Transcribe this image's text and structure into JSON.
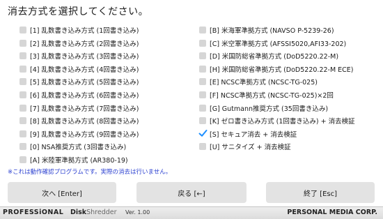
{
  "title": "消去方式を選択してください。",
  "options_left": [
    {
      "label": "[1] 乱数書き込み方式 (1回書き込み)",
      "checked": false
    },
    {
      "label": "[2] 乱数書き込み方式 (2回書き込み)",
      "checked": false
    },
    {
      "label": "[3] 乱数書き込み方式 (3回書き込み)",
      "checked": false
    },
    {
      "label": "[4] 乱数書き込み方式 (4回書き込み)",
      "checked": false
    },
    {
      "label": "[5] 乱数書き込み方式 (5回書き込み)",
      "checked": false
    },
    {
      "label": "[6] 乱数書き込み方式 (6回書き込み)",
      "checked": false
    },
    {
      "label": "[7] 乱数書き込み方式 (7回書き込み)",
      "checked": false
    },
    {
      "label": "[8] 乱数書き込み方式 (8回書き込み)",
      "checked": false
    },
    {
      "label": "[9] 乱数書き込み方式 (9回書き込み)",
      "checked": false
    },
    {
      "label": "[0] NSA推奨方式 (3回書き込み)",
      "checked": false
    },
    {
      "label": "[A] 米陸軍準拠方式 (AR380-19)",
      "checked": false
    }
  ],
  "options_right": [
    {
      "label": "[B] 米海軍準拠方式 (NAVSO P-5239-26)",
      "checked": false
    },
    {
      "label": "[C] 米空軍準拠方式 (AFSSI5020,AFI33-202)",
      "checked": false
    },
    {
      "label": "[D] 米国防総省準拠方式 (DoD5220.22-M)",
      "checked": false
    },
    {
      "label": "[H] 米国防総省準拠方式 (DoD5220.22-M ECE)",
      "checked": false
    },
    {
      "label": "[E] NCSC準拠方式 (NCSC-TG-025)",
      "checked": false
    },
    {
      "label": "[F] NCSC準拠方式 (NCSC-TG-025)×2回",
      "checked": false
    },
    {
      "label": "[G] Gutmann推奨方式 (35回書き込み)",
      "checked": false
    },
    {
      "label": "[K] ゼロ書き込み方式 (1回書き込み) + 消去検証",
      "checked": false
    },
    {
      "label": "[S] セキュア消去 + 消去検証",
      "checked": true
    },
    {
      "label": "[U] サニタイズ + 消去検証",
      "checked": false
    }
  ],
  "note": "※これは動作確認プログラムです。実際の消去は行いません。",
  "buttons": {
    "next": "次へ [Enter]",
    "back": "戻る [←]",
    "quit": "終了 [Esc]"
  },
  "footer": {
    "pro": "PROFESSiONAL",
    "brand_a": "Disk",
    "brand_b": "Shredder",
    "version": "Ver. 1.00",
    "company": "PERSONAL MEDIA CORP."
  },
  "colors": {
    "check_accent": "#1e8fff",
    "note_color": "#2a3fd0"
  }
}
